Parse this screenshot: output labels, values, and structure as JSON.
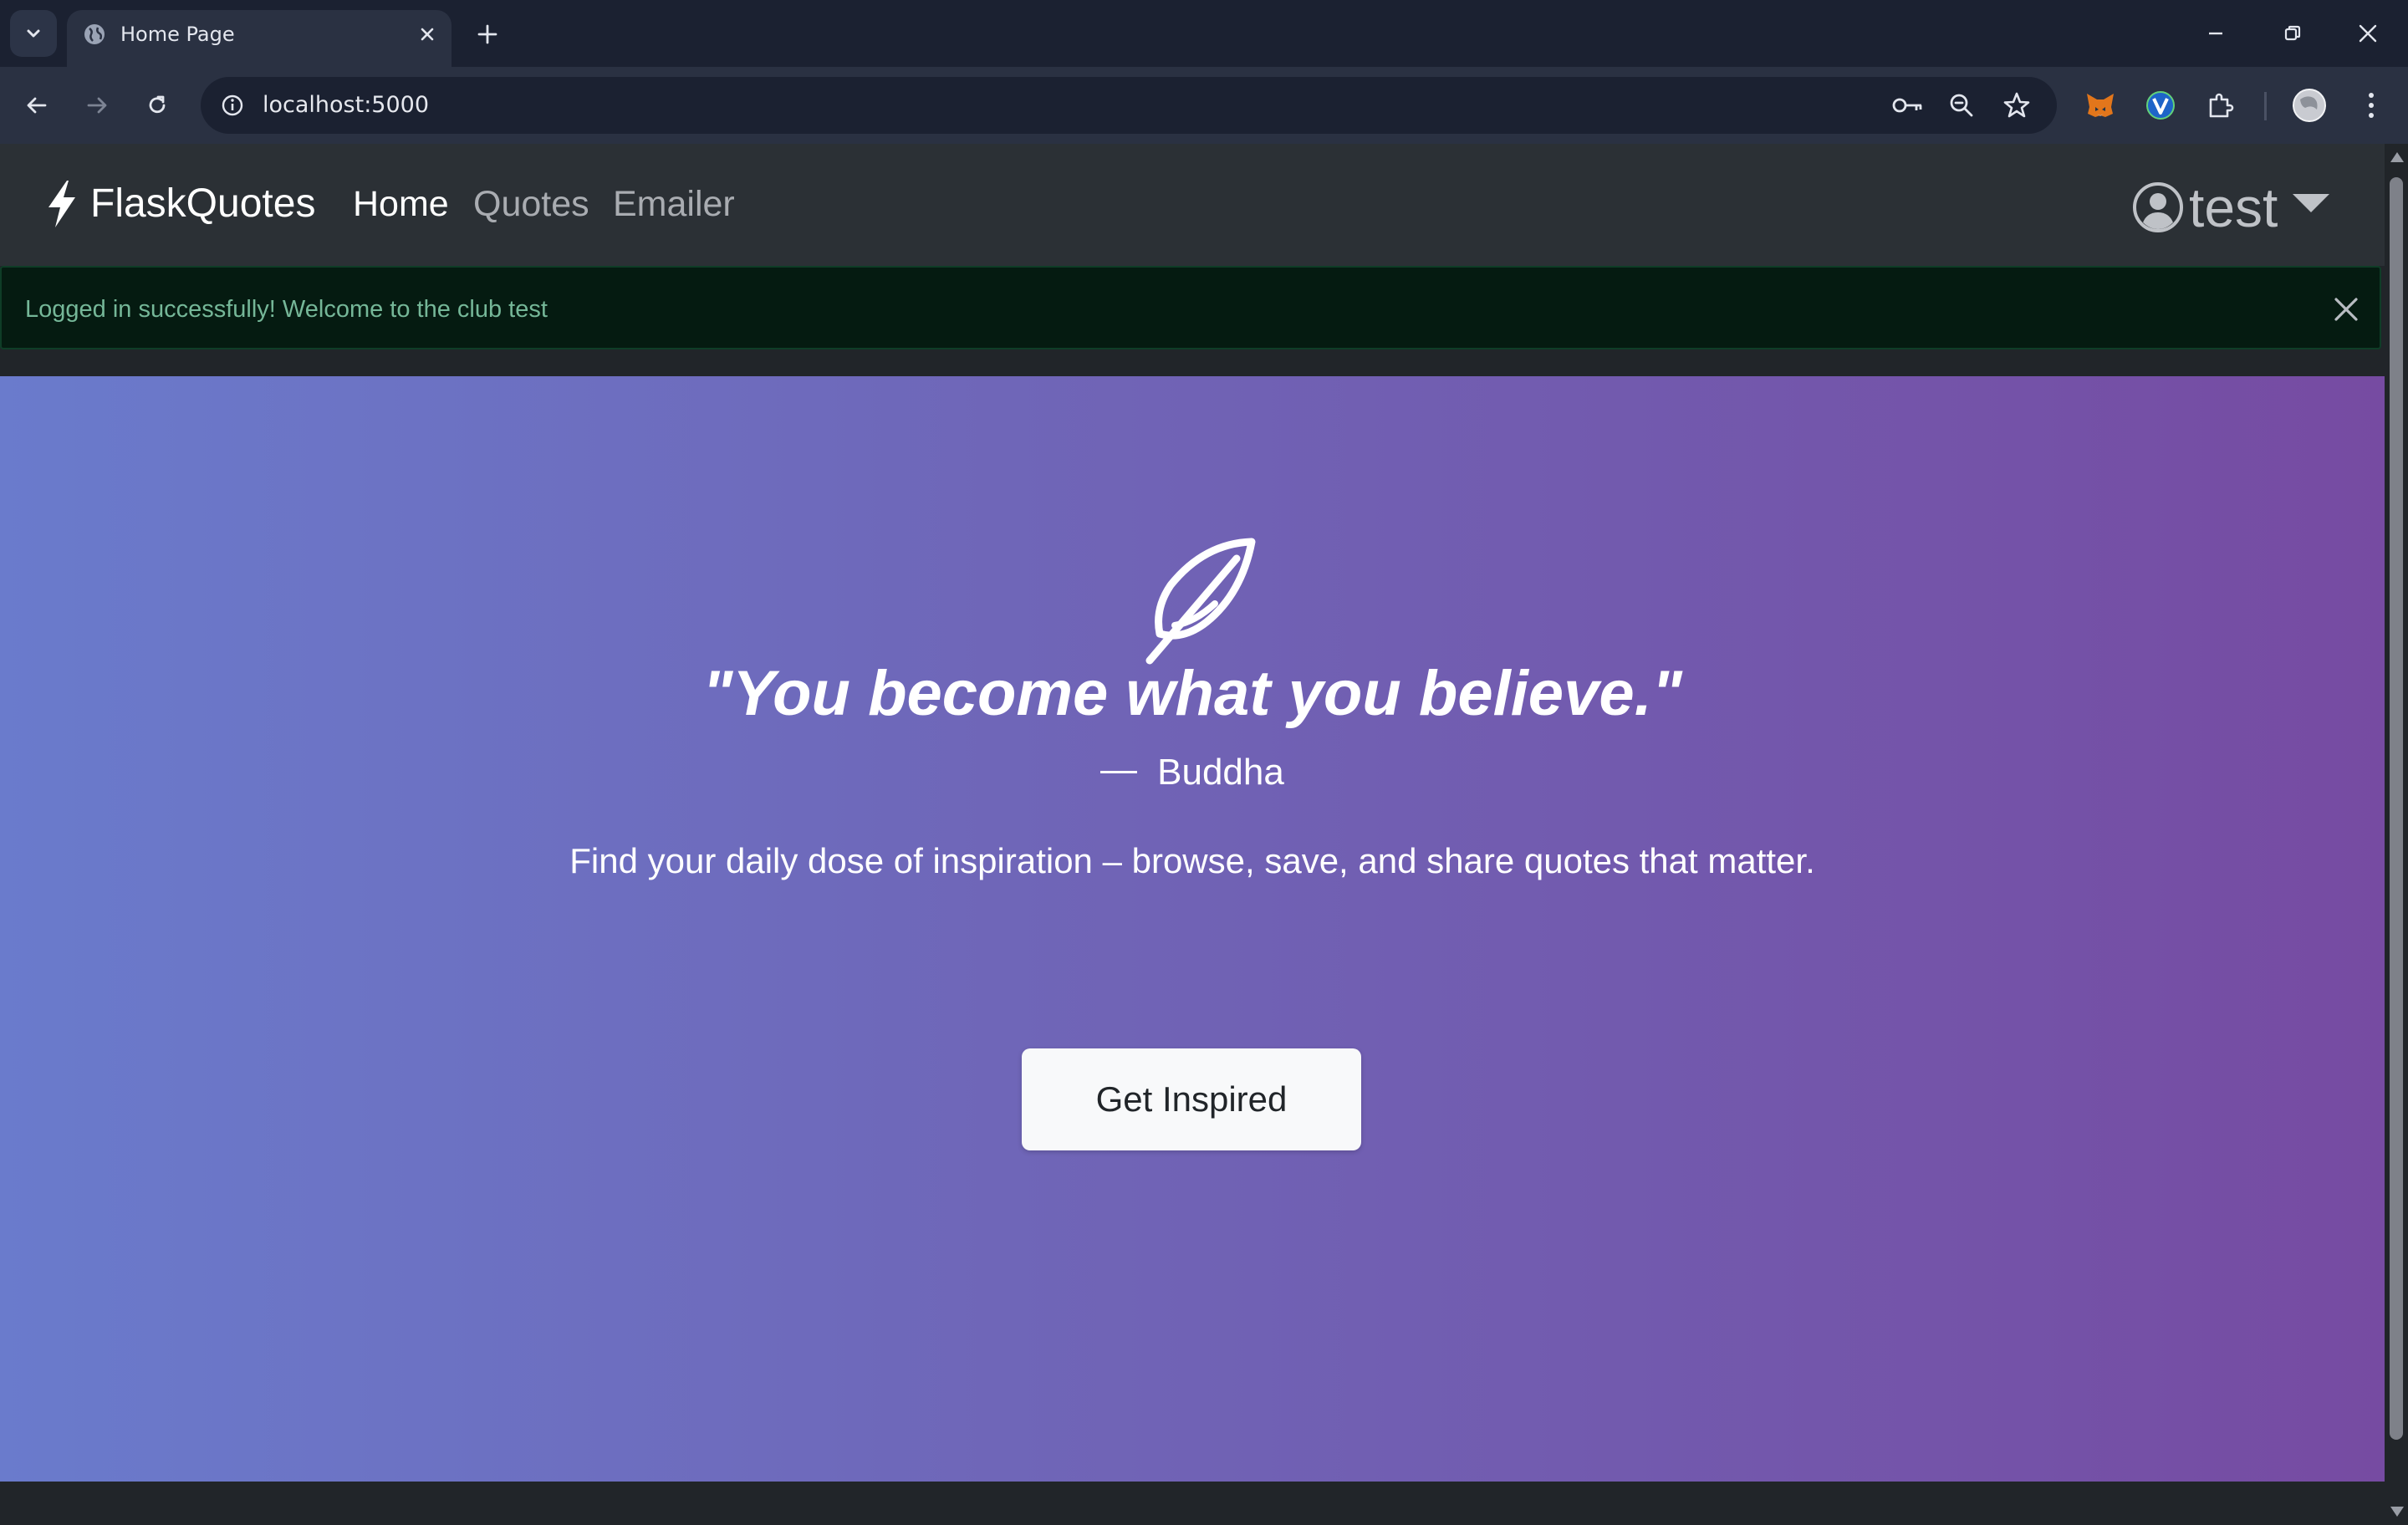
{
  "browser": {
    "tab_title": "Home Page",
    "url": "localhost:5000"
  },
  "navbar": {
    "brand": "FlaskQuotes",
    "links": [
      {
        "label": "Home",
        "active": true
      },
      {
        "label": "Quotes",
        "active": false
      },
      {
        "label": "Emailer",
        "active": false
      }
    ],
    "user": "test"
  },
  "alert": {
    "message": "Logged in successfully! Welcome to the club test"
  },
  "hero": {
    "quote": "\"You become what you believe.\"",
    "author": "Buddha",
    "tagline": "Find your daily dose of inspiration – browse, save, and share quotes that matter.",
    "cta_label": "Get Inspired"
  },
  "colors": {
    "gradient_start": "#6a7bcc",
    "gradient_end": "#764ba2",
    "alert_bg": "#051b11",
    "alert_text": "#75b798",
    "navbar_bg": "#2b3035"
  }
}
